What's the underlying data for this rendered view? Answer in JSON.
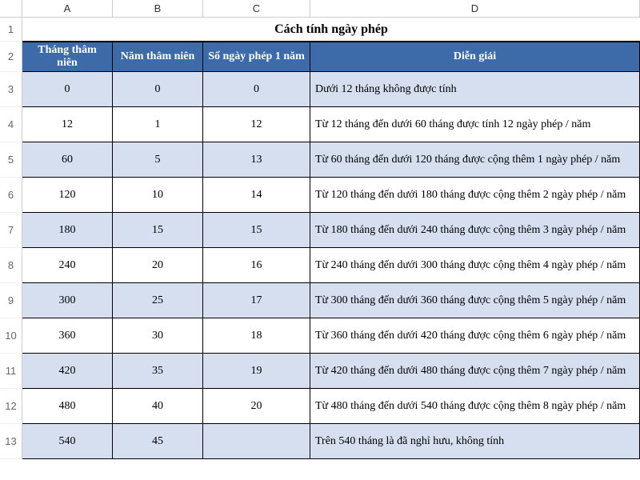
{
  "columns": {
    "A": "A",
    "B": "B",
    "C": "C",
    "D": "D"
  },
  "rowNumbers": [
    "1",
    "2",
    "3",
    "4",
    "5",
    "6",
    "7",
    "8",
    "9",
    "10",
    "11",
    "12",
    "13"
  ],
  "title": "Cách tính ngày phép",
  "headers": {
    "A": "Tháng thâm niên",
    "B": "Năm thâm niên",
    "C": "Số ngày phép 1 năm",
    "D": "Diễn giải"
  },
  "rows": [
    {
      "A": "0",
      "B": "0",
      "C": "0",
      "D": "Dưới 12 tháng không được tính"
    },
    {
      "A": "12",
      "B": "1",
      "C": "12",
      "D": "Từ 12 tháng đến dưới 60 tháng được tính 12 ngày phép / năm"
    },
    {
      "A": "60",
      "B": "5",
      "C": "13",
      "D": "Từ 60 tháng đến dưới 120 tháng được cộng thêm 1 ngày phép / năm"
    },
    {
      "A": "120",
      "B": "10",
      "C": "14",
      "D": "Từ 120 tháng đến dưới 180 tháng được cộng thêm 2 ngày phép / năm"
    },
    {
      "A": "180",
      "B": "15",
      "C": "15",
      "D": "Từ 180 tháng đến dưới 240 tháng được cộng thêm 3 ngày phép / năm"
    },
    {
      "A": "240",
      "B": "20",
      "C": "16",
      "D": "Từ 240 tháng đến dưới 300 tháng được cộng thêm 4 ngày phép / năm"
    },
    {
      "A": "300",
      "B": "25",
      "C": "17",
      "D": "Từ 300 tháng đến dưới 360 tháng được cộng thêm 5 ngày phép / năm"
    },
    {
      "A": "360",
      "B": "30",
      "C": "18",
      "D": "Từ 360 tháng đến dưới 420 tháng được cộng thêm 6 ngày phép / năm"
    },
    {
      "A": "420",
      "B": "35",
      "C": "19",
      "D": "Từ 420 tháng đến dưới 480 tháng được cộng thêm 7 ngày phép / năm"
    },
    {
      "A": "480",
      "B": "40",
      "C": "20",
      "D": "Từ 480 tháng đến dưới 540 tháng được cộng thêm 8 ngày phép / năm"
    },
    {
      "A": "540",
      "B": "45",
      "C": "",
      "D": "Trên 540 tháng là đã nghỉ hưu, không tính"
    }
  ]
}
